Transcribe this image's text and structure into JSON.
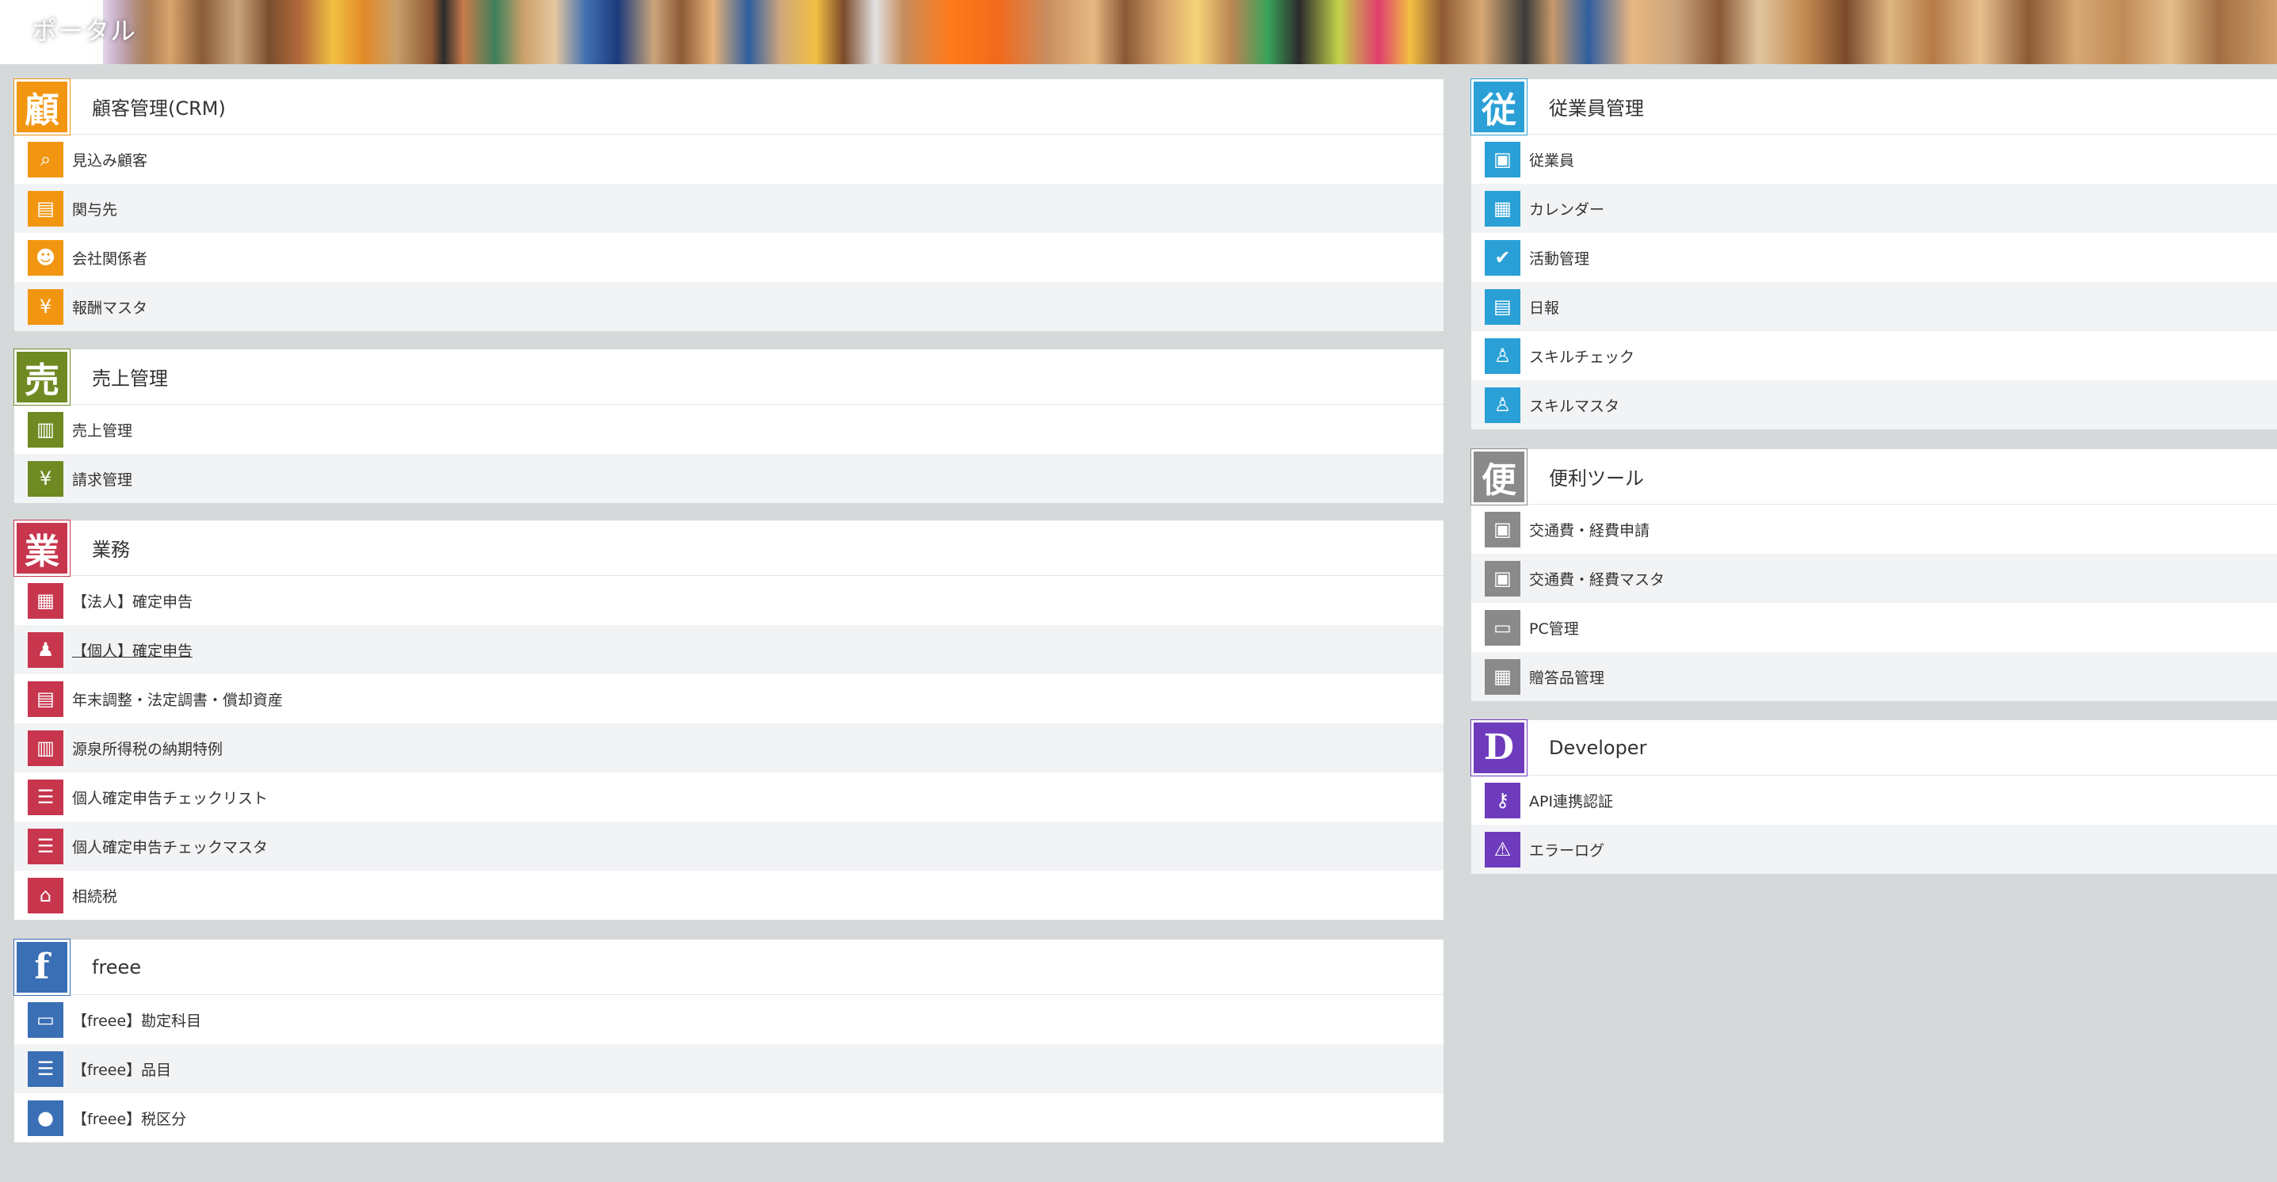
{
  "header": {
    "title": "ポータル"
  },
  "left_panels": [
    {
      "kanji": "顧",
      "title": "顧客管理(CRM)",
      "color": "#f29612",
      "items": [
        {
          "label": "見込み顧客",
          "icon": "search-person-icon",
          "glyph": "⌕"
        },
        {
          "label": "関与先",
          "icon": "building-icon",
          "glyph": "▤"
        },
        {
          "label": "会社関係者",
          "icon": "group-icon",
          "glyph": "☻"
        },
        {
          "label": "報酬マスタ",
          "icon": "reward-icon",
          "glyph": "¥"
        }
      ]
    },
    {
      "kanji": "売",
      "title": "売上管理",
      "color": "#6f8a22",
      "items": [
        {
          "label": "売上管理",
          "icon": "chart-icon",
          "glyph": "▥"
        },
        {
          "label": "請求管理",
          "icon": "money-bag-icon",
          "glyph": "¥"
        }
      ]
    },
    {
      "kanji": "業",
      "title": "業務",
      "color": "#c7364d",
      "items": [
        {
          "label": "【法人】確定申告",
          "icon": "corporate-document-icon",
          "glyph": "▦"
        },
        {
          "label": "【個人】確定申告",
          "icon": "personal-document-icon",
          "glyph": "♟"
        },
        {
          "label": "年末調整・法定調書・償却資産",
          "icon": "documents-icon",
          "glyph": "▤"
        },
        {
          "label": "源泉所得税の納期特例",
          "icon": "receipt-icon",
          "glyph": "▥"
        },
        {
          "label": "個人確定申告チェックリスト",
          "icon": "clipboard-icon",
          "glyph": "☰"
        },
        {
          "label": "個人確定申告チェックマスタ",
          "icon": "clipboard-stack-icon",
          "glyph": "☰"
        },
        {
          "label": "相続税",
          "icon": "house-icon",
          "glyph": "⌂"
        }
      ]
    },
    {
      "kanji": "f",
      "title": "freee",
      "color": "#3a6fb5",
      "items": [
        {
          "label": "【freee】勘定科目",
          "icon": "ledger-icon",
          "glyph": "▭"
        },
        {
          "label": "【freee】品目",
          "icon": "list-icon",
          "glyph": "☰"
        },
        {
          "label": "【freee】税区分",
          "icon": "tax-icon",
          "glyph": "●"
        }
      ]
    }
  ],
  "right_panels": [
    {
      "kanji": "従",
      "title": "従業員管理",
      "color": "#2aa0d6",
      "items": [
        {
          "label": "従業員",
          "icon": "id-card-icon",
          "glyph": "▣"
        },
        {
          "label": "カレンダー",
          "icon": "calendar-icon",
          "glyph": "▦"
        },
        {
          "label": "活動管理",
          "icon": "check-icon",
          "glyph": "✔"
        },
        {
          "label": "日報",
          "icon": "report-icon",
          "glyph": "▤"
        },
        {
          "label": "スキルチェック",
          "icon": "skill-check-icon",
          "glyph": "♙"
        },
        {
          "label": "スキルマスタ",
          "icon": "skill-master-icon",
          "glyph": "♙"
        }
      ]
    },
    {
      "kanji": "便",
      "title": "便利ツール",
      "color": "#8a8a8a",
      "items": [
        {
          "label": "交通費・経費申請",
          "icon": "train-icon",
          "glyph": "▣"
        },
        {
          "label": "交通費・経費マスタ",
          "icon": "train-master-icon",
          "glyph": "▣"
        },
        {
          "label": "PC管理",
          "icon": "computer-icon",
          "glyph": "▭"
        },
        {
          "label": "贈答品管理",
          "icon": "gift-icon",
          "glyph": "▦"
        }
      ]
    },
    {
      "kanji": "D",
      "title": "Developer",
      "color": "#6e3bbd",
      "items": [
        {
          "label": "API連携認証",
          "icon": "key-icon",
          "glyph": "⚷"
        },
        {
          "label": "エラーログ",
          "icon": "warning-icon",
          "glyph": "⚠"
        }
      ]
    }
  ]
}
